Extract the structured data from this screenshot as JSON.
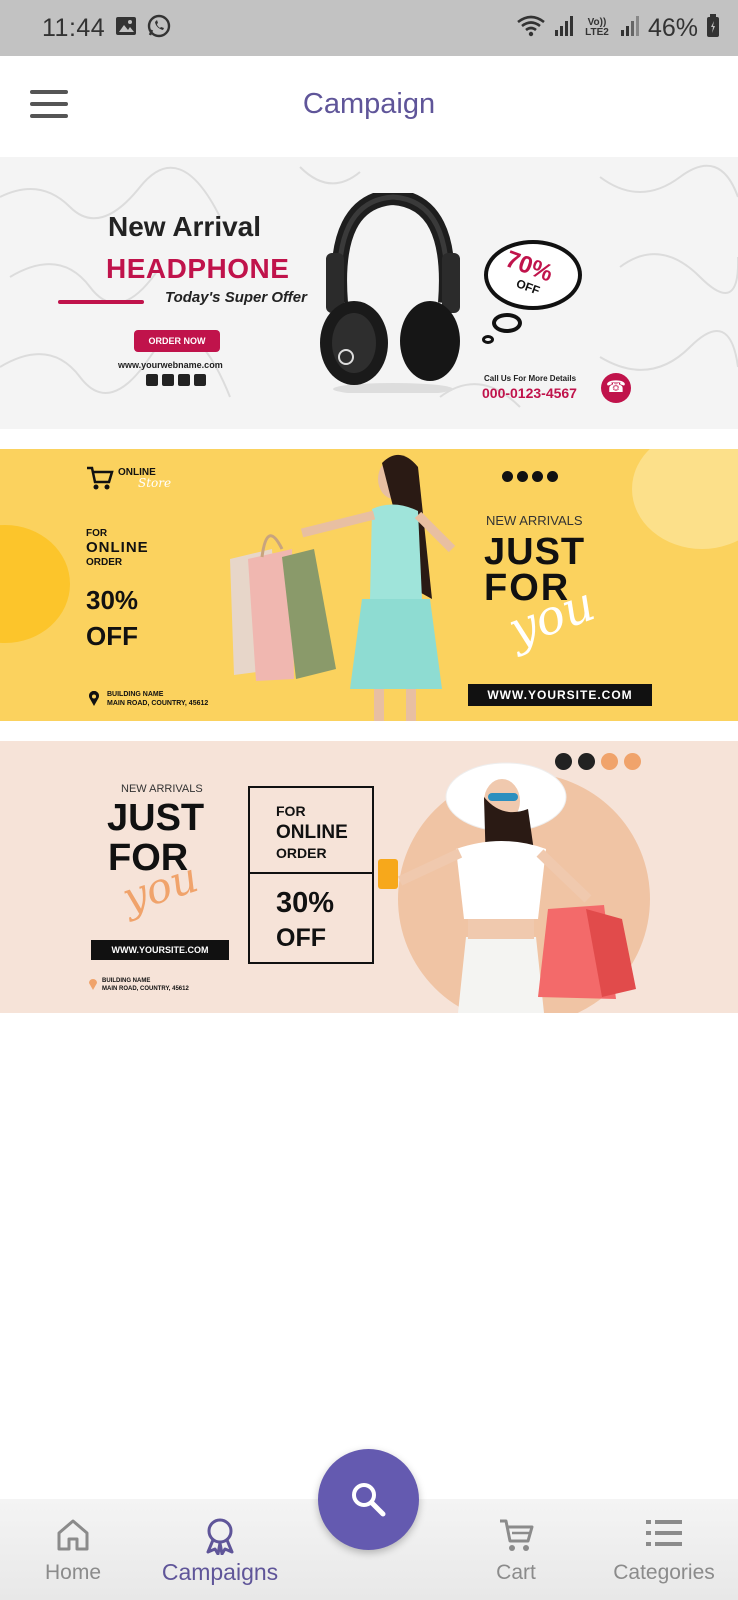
{
  "status_bar": {
    "time": "11:44",
    "network": "Vo)) LTE2",
    "battery": "46%"
  },
  "header": {
    "title": "Campaign"
  },
  "banners": [
    {
      "headline": "New Arrival",
      "product": "HEADPHONE",
      "tagline": "Today's Super Offer",
      "cta": "ORDER NOW",
      "url": "www.yourwebname.com",
      "discount": "70%",
      "discount_suffix": "OFF",
      "contact_label": "Call Us For More Details",
      "phone": "000-0123-4567"
    },
    {
      "brand_top": "ONLINE",
      "brand_bottom": "Store",
      "offer_for": "FOR",
      "offer_online": "ONLINE",
      "offer_order": "ORDER",
      "discount": "30%",
      "discount_suffix": "OFF",
      "address_line1": "BUILDING NAME",
      "address_line2": "MAIN ROAD, COUNTRY, 45612",
      "new_arrivals": "NEW ARRIVALS",
      "just": "JUST",
      "for": "FOR",
      "you": "you",
      "url": "WWW.YOURSITE.COM"
    },
    {
      "new_arrivals": "NEW ARRIVALS",
      "just": "JUST",
      "for": "FOR",
      "you": "you",
      "url": "WWW.YOURSITE.COM",
      "address_line1": "BUILDING NAME",
      "address_line2": "MAIN ROAD, COUNTRY, 45612",
      "offer_for": "FOR",
      "offer_online": "ONLINE",
      "offer_order": "ORDER",
      "discount": "30%",
      "discount_suffix": "OFF"
    }
  ],
  "bottom_nav": {
    "items": [
      {
        "label": "Home",
        "icon": "home-icon"
      },
      {
        "label": "Campaigns",
        "icon": "award-icon",
        "active": true
      },
      {
        "label": "Cart",
        "icon": "cart-icon"
      },
      {
        "label": "Categories",
        "icon": "list-icon"
      }
    ],
    "fab_icon": "search-icon"
  },
  "colors": {
    "accent": "#645ab0",
    "title": "#5f5599",
    "brand_red": "#c0134b",
    "banner_yellow": "#fbd25e",
    "banner_peach": "#f6e3d8"
  }
}
